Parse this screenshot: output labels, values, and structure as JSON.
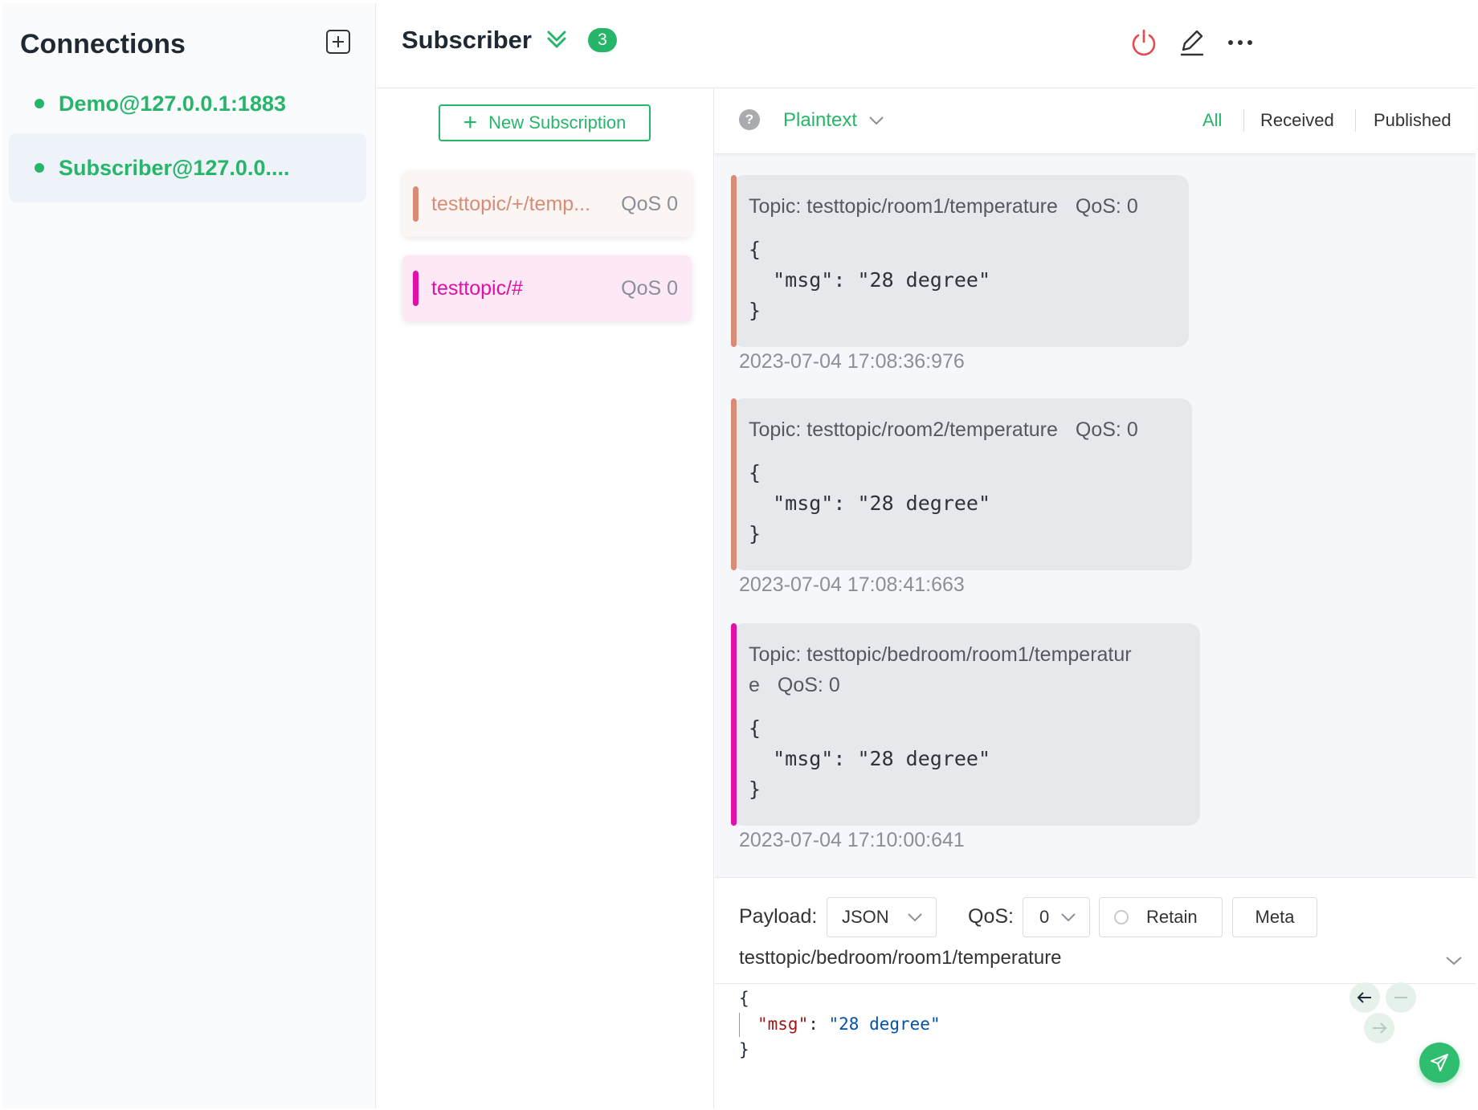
{
  "sidebar": {
    "title": "Connections",
    "connections": [
      {
        "label": "Demo@127.0.0.1:1883",
        "status": "connected",
        "active": false
      },
      {
        "label": "Subscriber@127.0.0....",
        "status": "connected",
        "active": true
      }
    ]
  },
  "header": {
    "title": "Subscriber",
    "badge_count": "3"
  },
  "subscriptions": {
    "new_button_label": "New Subscription",
    "items": [
      {
        "topic": "testtopic/+/temp...",
        "qos": "QoS 0",
        "color": "#d88c76",
        "bg": "#fbf6f3"
      },
      {
        "topic": "testtopic/#",
        "qos": "QoS 0",
        "color": "#e010a8",
        "bg": "#fde8f6"
      }
    ]
  },
  "filter": {
    "format": "Plaintext",
    "tabs": [
      "All",
      "Received",
      "Published"
    ],
    "active_tab": "All"
  },
  "messages": [
    {
      "topic_label": "Topic: testtopic/room1/temperature",
      "qos_label": "QoS: 0",
      "payload": "{\n  \"msg\": \"28 degree\"\n}",
      "time": "2023-07-04 17:08:36:976",
      "color": "#d88c76"
    },
    {
      "topic_label": "Topic: testtopic/room2/temperature",
      "qos_label": "QoS: 0",
      "payload": "{\n  \"msg\": \"28 degree\"\n}",
      "time": "2023-07-04 17:08:41:663",
      "color": "#d88c76"
    },
    {
      "topic_label_line1": "Topic: testtopic/bedroom/room1/temperatur",
      "topic_label_line2": "e",
      "qos_label": "QoS: 0",
      "payload": "{\n  \"msg\": \"28 degree\"\n}",
      "time": "2023-07-04 17:10:00:641",
      "color": "#e010a8"
    }
  ],
  "publish": {
    "payload_label": "Payload:",
    "payload_format": "JSON",
    "qos_label": "QoS:",
    "qos_value": "0",
    "retain_label": "Retain",
    "meta_label": "Meta",
    "topic": "testtopic/bedroom/room1/temperature",
    "editor": {
      "open": "{",
      "key": "\"msg\"",
      "colon": ": ",
      "value": "\"28 degree\"",
      "close": "}"
    }
  },
  "colors": {
    "accent": "#27b56a",
    "danger": "#e5484d"
  }
}
